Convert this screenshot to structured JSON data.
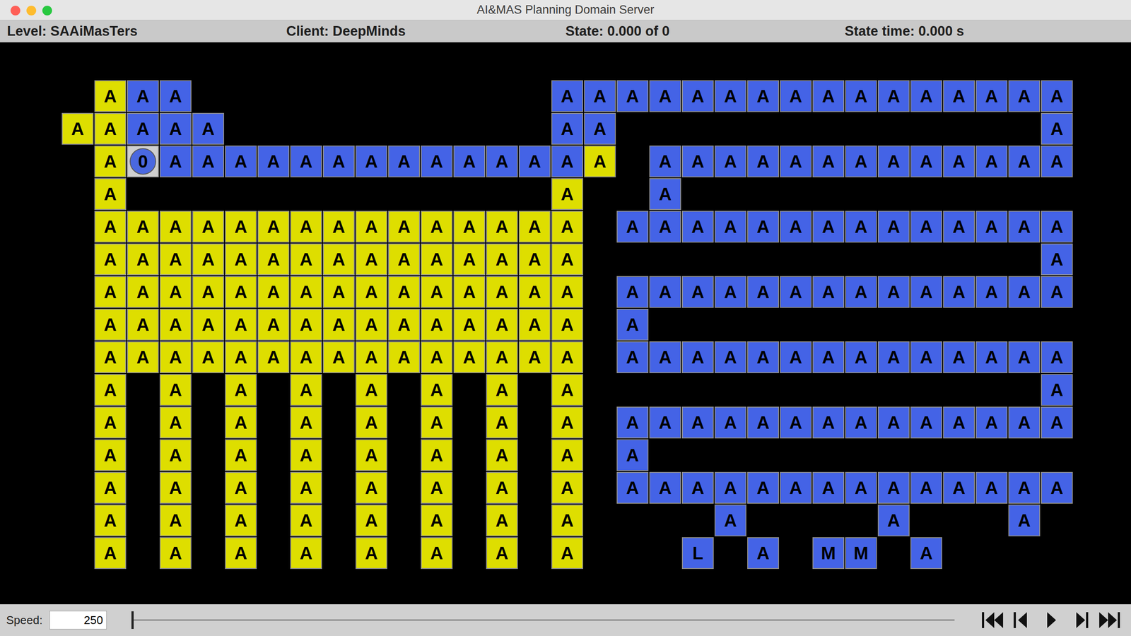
{
  "window": {
    "title": "AI&MAS Planning Domain Server"
  },
  "info_bar": [
    "Level: SAAiMasTers",
    "Client: DeepMinds",
    "State: 0.000 of 0",
    "State time: 0.000 s"
  ],
  "legend": {
    "y": {
      "kind": "box",
      "color": "#dede00"
    },
    "b": {
      "kind": "box",
      "color": "#4463e6"
    },
    "a": {
      "kind": "agent",
      "color": "#4a68e0"
    }
  },
  "level": {
    "letters": [
      ".AAA...........AAAAAAAAAAAAAAAA",
      "AAAAA..........AA.............A",
      ".A0AAAAAAAAAAAAAA.AAAAAAAAAAAAA",
      ".A.............A..A............",
      ".AAAAAAAAAAAAAAA.AAAAAAAAAAAAAA",
      ".AAAAAAAAAAAAAAA..............A",
      ".AAAAAAAAAAAAAAA.AAAAAAAAAAAAAA",
      ".AAAAAAAAAAAAAAA.A.............",
      ".AAAAAAAAAAAAAAA.AAAAAAAAAAAAAA",
      ".A.A.A.A.A.A.A.A..............A",
      ".A.A.A.A.A.A.A.A.AAAAAAAAAAAAAA",
      ".A.A.A.A.A.A.A.A.A.............",
      ".A.A.A.A.A.A.A.A.AAAAAAAAAAAAAA",
      ".A.A.A.A.A.A.A.A....A....A...A",
      ".A.A.A.A.A.A.A.A...L.A.MM.A...."
    ],
    "kinds": [
      ".ybb...........bbbbbbbbbbbbbbbb",
      "yybbb..........bb.............b",
      ".yabbbbbbbbbbbbby.bbbbbbbbbbbbb",
      ".y.............y..b............",
      ".yyyyyyyyyyyyyyy.bbbbbbbbbbbbbb",
      ".yyyyyyyyyyyyyyy..............b",
      ".yyyyyyyyyyyyyyy.bbbbbbbbbbbbbb",
      ".yyyyyyyyyyyyyyy.b.............",
      ".yyyyyyyyyyyyyyy.bbbbbbbbbbbbbb",
      ".y.y.y.y.y.y.y.y..............b",
      ".y.y.y.y.y.y.y.y.bbbbbbbbbbbbbb",
      ".y.y.y.y.y.y.y.y.b.............",
      ".y.y.y.y.y.y.y.y.bbbbbbbbbbbbbb",
      ".y.y.y.y.y.y.y.y....b....b...b",
      ".y.y.y.y.y.y.y.y...b.b.bb.b...."
    ]
  },
  "controls": {
    "speed_label": "Speed:",
    "speed_value": "250",
    "timeline_level": 0
  }
}
